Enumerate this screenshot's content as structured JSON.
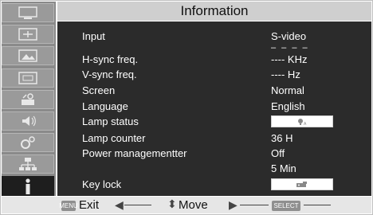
{
  "title": "Information",
  "rows": [
    {
      "label": "Input",
      "value": "S-video"
    },
    {
      "label": "",
      "value": "– – – –"
    },
    {
      "label": "H-sync freq.",
      "value": "---- KHz"
    },
    {
      "label": "V-sync freq.",
      "value": "----  Hz"
    },
    {
      "label": "Screen",
      "value": "Normal"
    },
    {
      "label": "Language",
      "value": "English"
    },
    {
      "label": "Lamp status",
      "value": ""
    },
    {
      "label": "Lamp counter",
      "value": "36 H"
    },
    {
      "label": "Power managementter",
      "value": "Off"
    },
    {
      "label": "",
      "value": "5 Min"
    },
    {
      "label": "Key lock",
      "value": ""
    }
  ],
  "sidebar_icons": [
    "display-icon",
    "pc-adjust-icon",
    "image-select-icon",
    "screen-icon",
    "setting-icon",
    "sound-icon",
    "expand-icon",
    "network-icon",
    "information-icon"
  ],
  "help": {
    "menu_key": "MENU",
    "exit_label": "Exit",
    "move_label": "Move",
    "select_key": "SELECT"
  },
  "colors": {
    "panel": "#2b2b2b",
    "sidebar": "#8a8a8a",
    "active_icon_bg": "#1e1e1e",
    "title_bar": "#cfcfcf"
  }
}
